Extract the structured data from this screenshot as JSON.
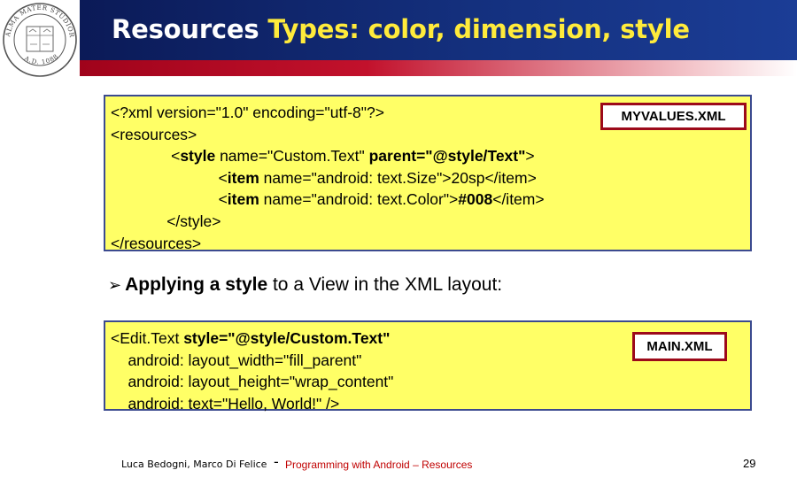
{
  "seal": {
    "text": "ALMA MATER STUDIORUM · A.D. 1088"
  },
  "header": {
    "title_part1": "Resources ",
    "title_part2": "Types: color, dimension, style",
    "bg_color": "#14307e",
    "rule_color": "#c2112c"
  },
  "box1": {
    "bg_color": "#ffff66",
    "label": "MYVALUES.XML",
    "lines": [
      {
        "normal": "<?xml version=\"1.0\" encoding=\"utf-8\"?>"
      },
      {
        "normal": "<resources>"
      },
      {
        "indent": "              ",
        "normal": "<",
        "bold": "style",
        "normal2": " name=\"Custom.Text\" ",
        "bold2": "parent=\"@style/Text\"",
        "normal3": ">"
      },
      {
        "indent": "                         ",
        "normal": "<",
        "bold": "item",
        "normal2": " name=\"android: text.Size\">20sp</item>",
        "bold2": "",
        "normal3": ""
      },
      {
        "indent": "                         ",
        "normal": "<",
        "bold": "item",
        "normal2": " name=\"android: text.Color\">",
        "bold2": "#008",
        "normal3": "</item>"
      },
      {
        "normal": "             </style>"
      },
      {
        "normal": "</resources>"
      }
    ]
  },
  "bullet": {
    "bold_part": "Applying a style",
    "rest": " to a View in the XML layout:"
  },
  "box2": {
    "label": "MAIN.XML",
    "lines": [
      {
        "normal": "<Edit.Text ",
        "bold": "style=\"@style/Custom.Text\""
      },
      {
        "normal": "    android: layout_width=\"fill_parent\""
      },
      {
        "normal": "    android: layout_height=\"wrap_content\""
      },
      {
        "normal": "    android: text=\"Hello, World!\" />"
      }
    ]
  },
  "footer": {
    "authors": "Luca Bedogni, Marco Di Felice",
    "dash": "-",
    "course": "Programming with Android – Resources",
    "page": "29"
  }
}
